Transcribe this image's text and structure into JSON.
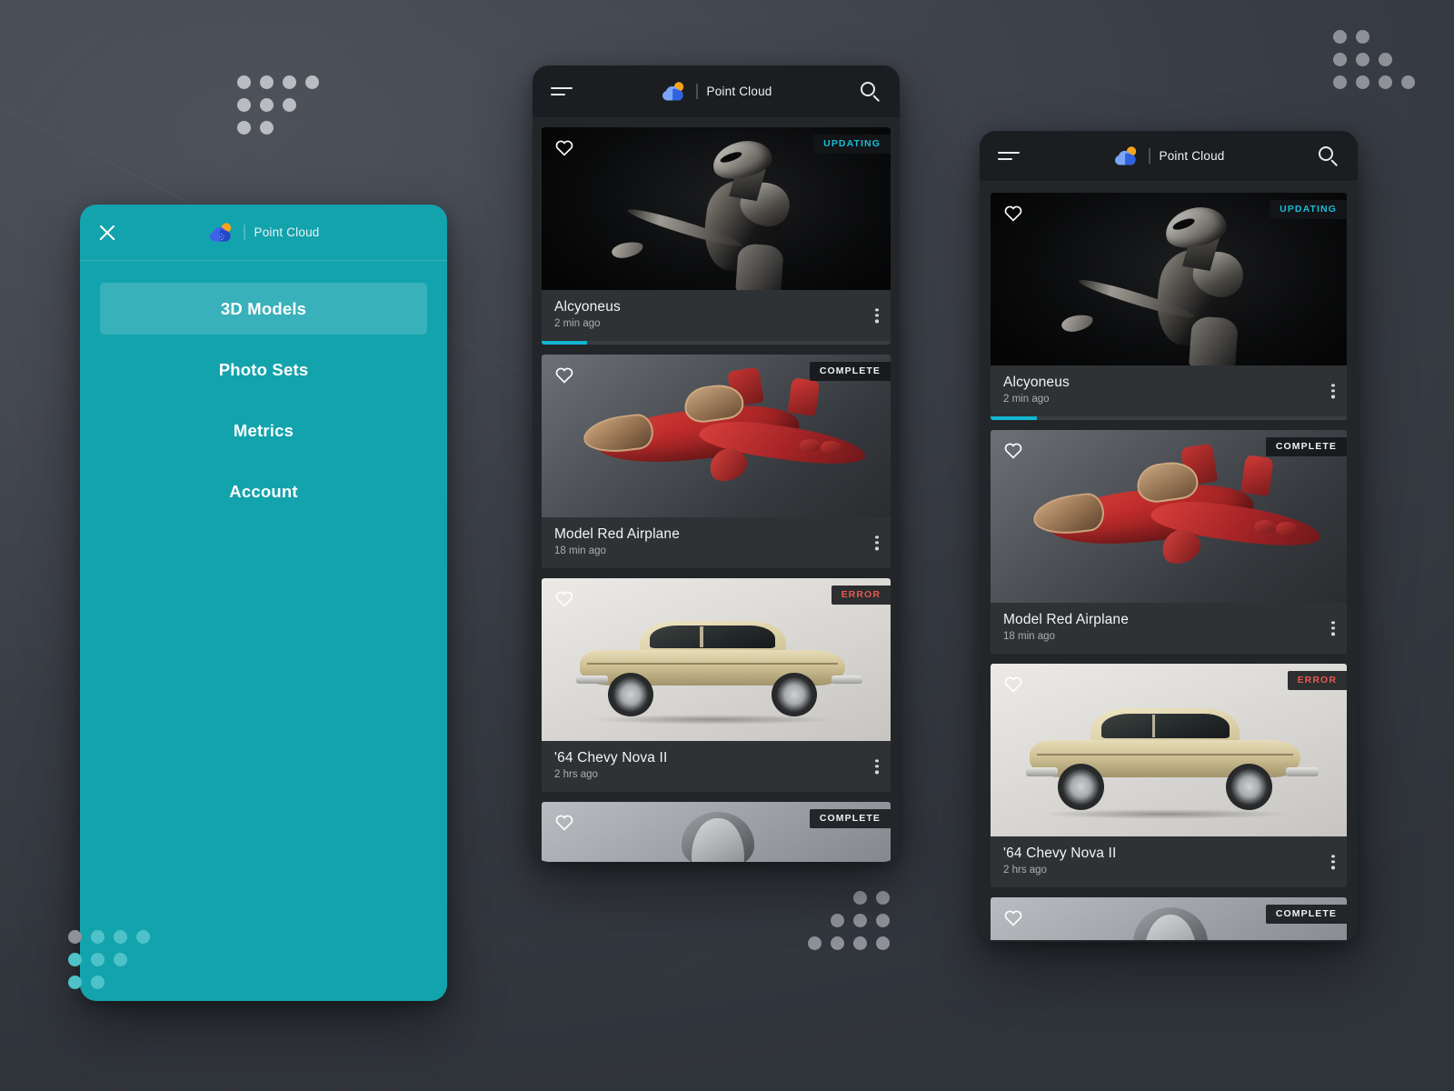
{
  "app": {
    "name": "Point Cloud",
    "accent_teal": "#13a3ad",
    "accent_cyan": "#13b6d4",
    "error_red": "#e8584f",
    "dark_bg": "#232629",
    "appbar_bg": "#1b1d20"
  },
  "drawer": {
    "close_icon": "close-icon",
    "logo_icon": "point-cloud-logo-icon",
    "brand": "Point Cloud",
    "items": [
      {
        "label": "3D Models",
        "active": true
      },
      {
        "label": "Photo Sets",
        "active": false
      },
      {
        "label": "Metrics",
        "active": false
      },
      {
        "label": "Account",
        "active": false
      }
    ]
  },
  "appbar": {
    "menu_icon": "hamburger-menu-icon",
    "logo_icon": "point-cloud-logo-icon",
    "title": "Point Cloud",
    "search_icon": "search-icon"
  },
  "feed": {
    "favorite_icon": "heart-icon",
    "overflow_icon": "kebab-menu-icon",
    "cards": [
      {
        "title": "Alcyoneus",
        "time": "2 min ago",
        "status": "UPDATING",
        "status_kind": "updating",
        "progress": 13,
        "art": "alien"
      },
      {
        "title": "Model Red Airplane",
        "time": "18 min ago",
        "status": "COMPLETE",
        "status_kind": "complete",
        "progress": null,
        "art": "plane"
      },
      {
        "title": "'64 Chevy Nova II",
        "time": "2 hrs ago",
        "status": "ERROR",
        "status_kind": "error",
        "progress": null,
        "art": "car"
      },
      {
        "title": "",
        "time": "",
        "status": "COMPLETE",
        "status_kind": "complete",
        "progress": null,
        "art": "bust"
      }
    ]
  },
  "decor": {
    "dot_clusters": [
      {
        "name": "dots-top-left",
        "shape": "triangle-down",
        "color": "#b9bcc1"
      },
      {
        "name": "dots-top-right",
        "shape": "triangle-up",
        "color": "#8e9298"
      },
      {
        "name": "dots-bottom-left",
        "shape": "triangle-down",
        "color": "#4fc2c9"
      },
      {
        "name": "dots-bottom-center",
        "shape": "triangle-up",
        "color": "#8e9298"
      }
    ]
  }
}
